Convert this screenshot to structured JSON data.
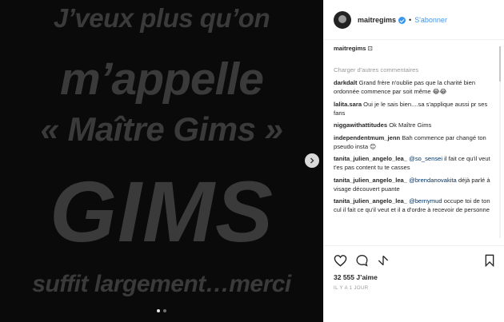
{
  "media": {
    "lines": [
      "J’veux plus qu’on",
      "m’appelle",
      "« Maître Gims »",
      "GIMS",
      "suffit largement…merci"
    ]
  },
  "header": {
    "username": "maitregims",
    "separator": "•",
    "follow_label": "S'abonner"
  },
  "caption": {
    "username": "maitregims",
    "text": " ⊡"
  },
  "load_more": "Charger d'autres commentaires",
  "comments": [
    {
      "user": "darkdalt",
      "mention": "",
      "text": " Grand frère n'oublie pas que la charité bien ordonnée commence par soit même 😂😂"
    },
    {
      "user": "lalita.sara",
      "mention": "",
      "text": " Oui je le sais bien....sa s'applique aussi pr ses fans"
    },
    {
      "user": "niggawithattitudes",
      "mention": "",
      "text": " Ok Maître Gims"
    },
    {
      "user": "independentmum_jenn",
      "mention": "",
      "text": " Bah commence par changé ton pseudo insta 😊"
    },
    {
      "user": "tanita_julien_angelo_lea_",
      "mention": " @so_sensei",
      "text": " il fait ce qu'il veut t'es pas content tu te casses"
    },
    {
      "user": "tanita_julien_angelo_lea_",
      "mention": " @brendanovakita",
      "text": " déjà parlé à visage découvert puante"
    },
    {
      "user": "tanita_julien_angelo_lea_",
      "mention": " @bernymud",
      "text": " occupe toi de ton cul il fait ce qu'il veut et il a d'ordre à recevoir de personne"
    }
  ],
  "likes": "32 555 J’aime",
  "timestamp": "IL Y A 1 JOUR",
  "colors": {
    "accent": "#3897f0",
    "mention": "#003569"
  }
}
